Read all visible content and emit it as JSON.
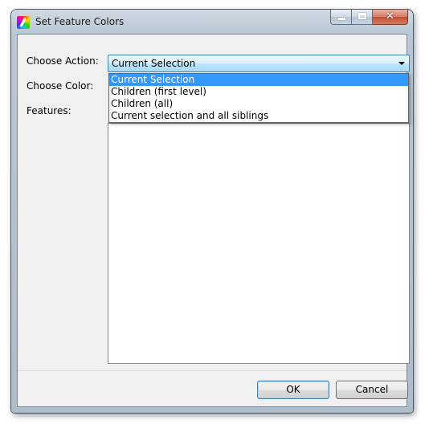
{
  "window": {
    "title": "Set Feature Colors"
  },
  "caption": {
    "close_glyph": "✕"
  },
  "form": {
    "action_label": "Choose Action:",
    "color_label": "Choose Color:",
    "features_label": "Features:"
  },
  "action_combo": {
    "value": "Current Selection",
    "options": [
      "Current Selection",
      "Children (first level)",
      "Children (all)",
      "Current selection and all siblings"
    ],
    "selected_index": 0
  },
  "buttons": {
    "ok_label": "OK",
    "cancel_label": "Cancel"
  },
  "colors": {
    "selection_highlight": "#3399ff",
    "combo_border": "#3c7fb1"
  }
}
